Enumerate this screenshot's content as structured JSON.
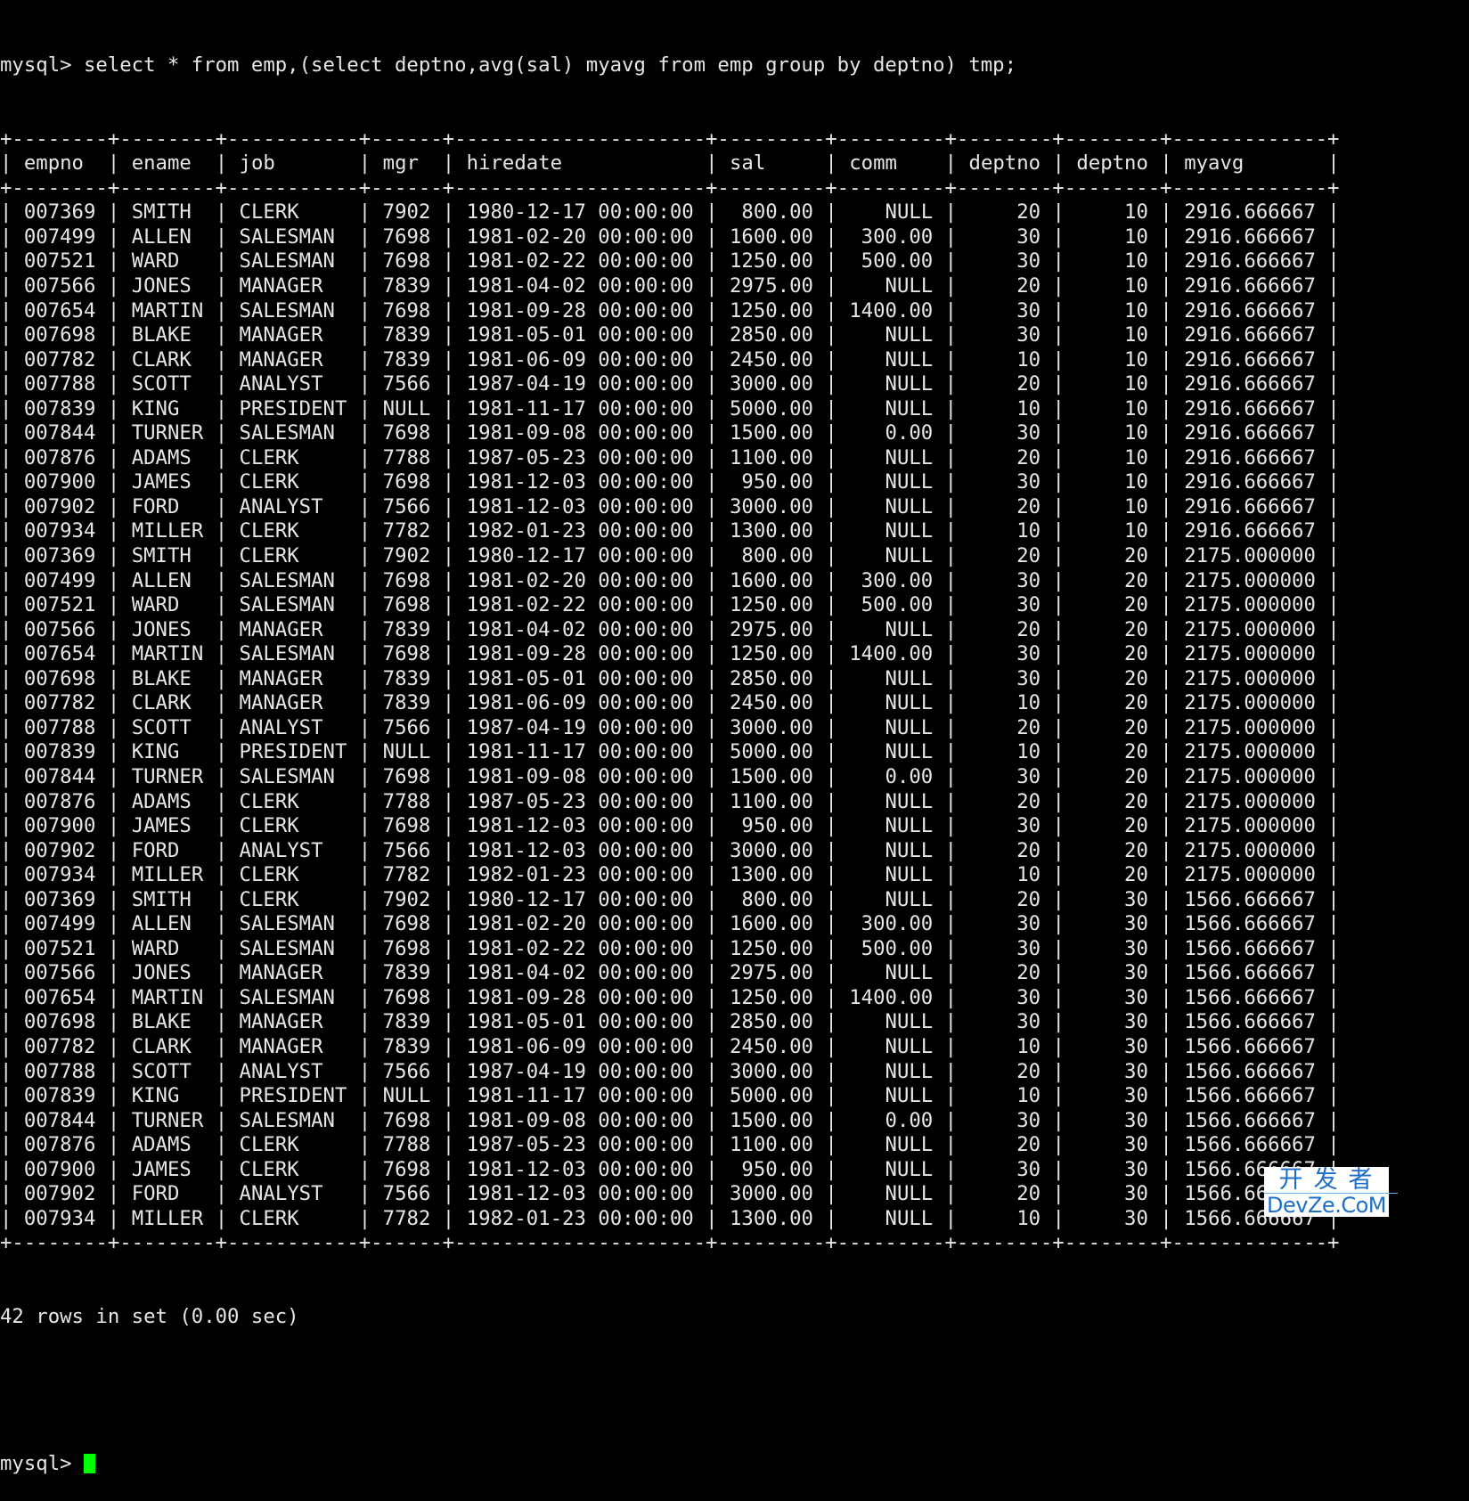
{
  "terminal": {
    "prompt": "mysql> ",
    "command": "select * from emp,(select deptno,avg(sal) myavg from emp group by deptno) tmp;",
    "result_summary": "42 rows in set (0.00 sec)",
    "cursor_color": "#00ff00"
  },
  "table": {
    "columns": [
      "empno",
      "ename",
      "job",
      "mgr",
      "hiredate",
      "sal",
      "comm",
      "deptno",
      "deptno",
      "myavg"
    ],
    "align": [
      "left",
      "left",
      "left",
      "left",
      "left",
      "right",
      "right",
      "right",
      "right",
      "left"
    ],
    "widths": [
      6,
      6,
      9,
      4,
      19,
      7,
      7,
      6,
      6,
      11
    ],
    "rows": [
      [
        "007369",
        "SMITH",
        "CLERK",
        "7902",
        "1980-12-17 00:00:00",
        "800.00",
        "NULL",
        "20",
        "10",
        "2916.666667"
      ],
      [
        "007499",
        "ALLEN",
        "SALESMAN",
        "7698",
        "1981-02-20 00:00:00",
        "1600.00",
        "300.00",
        "30",
        "10",
        "2916.666667"
      ],
      [
        "007521",
        "WARD",
        "SALESMAN",
        "7698",
        "1981-02-22 00:00:00",
        "1250.00",
        "500.00",
        "30",
        "10",
        "2916.666667"
      ],
      [
        "007566",
        "JONES",
        "MANAGER",
        "7839",
        "1981-04-02 00:00:00",
        "2975.00",
        "NULL",
        "20",
        "10",
        "2916.666667"
      ],
      [
        "007654",
        "MARTIN",
        "SALESMAN",
        "7698",
        "1981-09-28 00:00:00",
        "1250.00",
        "1400.00",
        "30",
        "10",
        "2916.666667"
      ],
      [
        "007698",
        "BLAKE",
        "MANAGER",
        "7839",
        "1981-05-01 00:00:00",
        "2850.00",
        "NULL",
        "30",
        "10",
        "2916.666667"
      ],
      [
        "007782",
        "CLARK",
        "MANAGER",
        "7839",
        "1981-06-09 00:00:00",
        "2450.00",
        "NULL",
        "10",
        "10",
        "2916.666667"
      ],
      [
        "007788",
        "SCOTT",
        "ANALYST",
        "7566",
        "1987-04-19 00:00:00",
        "3000.00",
        "NULL",
        "20",
        "10",
        "2916.666667"
      ],
      [
        "007839",
        "KING",
        "PRESIDENT",
        "NULL",
        "1981-11-17 00:00:00",
        "5000.00",
        "NULL",
        "10",
        "10",
        "2916.666667"
      ],
      [
        "007844",
        "TURNER",
        "SALESMAN",
        "7698",
        "1981-09-08 00:00:00",
        "1500.00",
        "0.00",
        "30",
        "10",
        "2916.666667"
      ],
      [
        "007876",
        "ADAMS",
        "CLERK",
        "7788",
        "1987-05-23 00:00:00",
        "1100.00",
        "NULL",
        "20",
        "10",
        "2916.666667"
      ],
      [
        "007900",
        "JAMES",
        "CLERK",
        "7698",
        "1981-12-03 00:00:00",
        "950.00",
        "NULL",
        "30",
        "10",
        "2916.666667"
      ],
      [
        "007902",
        "FORD",
        "ANALYST",
        "7566",
        "1981-12-03 00:00:00",
        "3000.00",
        "NULL",
        "20",
        "10",
        "2916.666667"
      ],
      [
        "007934",
        "MILLER",
        "CLERK",
        "7782",
        "1982-01-23 00:00:00",
        "1300.00",
        "NULL",
        "10",
        "10",
        "2916.666667"
      ],
      [
        "007369",
        "SMITH",
        "CLERK",
        "7902",
        "1980-12-17 00:00:00",
        "800.00",
        "NULL",
        "20",
        "20",
        "2175.000000"
      ],
      [
        "007499",
        "ALLEN",
        "SALESMAN",
        "7698",
        "1981-02-20 00:00:00",
        "1600.00",
        "300.00",
        "30",
        "20",
        "2175.000000"
      ],
      [
        "007521",
        "WARD",
        "SALESMAN",
        "7698",
        "1981-02-22 00:00:00",
        "1250.00",
        "500.00",
        "30",
        "20",
        "2175.000000"
      ],
      [
        "007566",
        "JONES",
        "MANAGER",
        "7839",
        "1981-04-02 00:00:00",
        "2975.00",
        "NULL",
        "20",
        "20",
        "2175.000000"
      ],
      [
        "007654",
        "MARTIN",
        "SALESMAN",
        "7698",
        "1981-09-28 00:00:00",
        "1250.00",
        "1400.00",
        "30",
        "20",
        "2175.000000"
      ],
      [
        "007698",
        "BLAKE",
        "MANAGER",
        "7839",
        "1981-05-01 00:00:00",
        "2850.00",
        "NULL",
        "30",
        "20",
        "2175.000000"
      ],
      [
        "007782",
        "CLARK",
        "MANAGER",
        "7839",
        "1981-06-09 00:00:00",
        "2450.00",
        "NULL",
        "10",
        "20",
        "2175.000000"
      ],
      [
        "007788",
        "SCOTT",
        "ANALYST",
        "7566",
        "1987-04-19 00:00:00",
        "3000.00",
        "NULL",
        "20",
        "20",
        "2175.000000"
      ],
      [
        "007839",
        "KING",
        "PRESIDENT",
        "NULL",
        "1981-11-17 00:00:00",
        "5000.00",
        "NULL",
        "10",
        "20",
        "2175.000000"
      ],
      [
        "007844",
        "TURNER",
        "SALESMAN",
        "7698",
        "1981-09-08 00:00:00",
        "1500.00",
        "0.00",
        "30",
        "20",
        "2175.000000"
      ],
      [
        "007876",
        "ADAMS",
        "CLERK",
        "7788",
        "1987-05-23 00:00:00",
        "1100.00",
        "NULL",
        "20",
        "20",
        "2175.000000"
      ],
      [
        "007900",
        "JAMES",
        "CLERK",
        "7698",
        "1981-12-03 00:00:00",
        "950.00",
        "NULL",
        "30",
        "20",
        "2175.000000"
      ],
      [
        "007902",
        "FORD",
        "ANALYST",
        "7566",
        "1981-12-03 00:00:00",
        "3000.00",
        "NULL",
        "20",
        "20",
        "2175.000000"
      ],
      [
        "007934",
        "MILLER",
        "CLERK",
        "7782",
        "1982-01-23 00:00:00",
        "1300.00",
        "NULL",
        "10",
        "20",
        "2175.000000"
      ],
      [
        "007369",
        "SMITH",
        "CLERK",
        "7902",
        "1980-12-17 00:00:00",
        "800.00",
        "NULL",
        "20",
        "30",
        "1566.666667"
      ],
      [
        "007499",
        "ALLEN",
        "SALESMAN",
        "7698",
        "1981-02-20 00:00:00",
        "1600.00",
        "300.00",
        "30",
        "30",
        "1566.666667"
      ],
      [
        "007521",
        "WARD",
        "SALESMAN",
        "7698",
        "1981-02-22 00:00:00",
        "1250.00",
        "500.00",
        "30",
        "30",
        "1566.666667"
      ],
      [
        "007566",
        "JONES",
        "MANAGER",
        "7839",
        "1981-04-02 00:00:00",
        "2975.00",
        "NULL",
        "20",
        "30",
        "1566.666667"
      ],
      [
        "007654",
        "MARTIN",
        "SALESMAN",
        "7698",
        "1981-09-28 00:00:00",
        "1250.00",
        "1400.00",
        "30",
        "30",
        "1566.666667"
      ],
      [
        "007698",
        "BLAKE",
        "MANAGER",
        "7839",
        "1981-05-01 00:00:00",
        "2850.00",
        "NULL",
        "30",
        "30",
        "1566.666667"
      ],
      [
        "007782",
        "CLARK",
        "MANAGER",
        "7839",
        "1981-06-09 00:00:00",
        "2450.00",
        "NULL",
        "10",
        "30",
        "1566.666667"
      ],
      [
        "007788",
        "SCOTT",
        "ANALYST",
        "7566",
        "1987-04-19 00:00:00",
        "3000.00",
        "NULL",
        "20",
        "30",
        "1566.666667"
      ],
      [
        "007839",
        "KING",
        "PRESIDENT",
        "NULL",
        "1981-11-17 00:00:00",
        "5000.00",
        "NULL",
        "10",
        "30",
        "1566.666667"
      ],
      [
        "007844",
        "TURNER",
        "SALESMAN",
        "7698",
        "1981-09-08 00:00:00",
        "1500.00",
        "0.00",
        "30",
        "30",
        "1566.666667"
      ],
      [
        "007876",
        "ADAMS",
        "CLERK",
        "7788",
        "1987-05-23 00:00:00",
        "1100.00",
        "NULL",
        "20",
        "30",
        "1566.666667"
      ],
      [
        "007900",
        "JAMES",
        "CLERK",
        "7698",
        "1981-12-03 00:00:00",
        "950.00",
        "NULL",
        "30",
        "30",
        "1566.666667"
      ],
      [
        "007902",
        "FORD",
        "ANALYST",
        "7566",
        "1981-12-03 00:00:00",
        "3000.00",
        "NULL",
        "20",
        "30",
        "1566.666667"
      ],
      [
        "007934",
        "MILLER",
        "CLERK",
        "7782",
        "1982-01-23 00:00:00",
        "1300.00",
        "NULL",
        "10",
        "30",
        "1566.666667"
      ]
    ]
  },
  "watermark": {
    "line1": "开发者",
    "line2": "DevZe.CoM"
  }
}
